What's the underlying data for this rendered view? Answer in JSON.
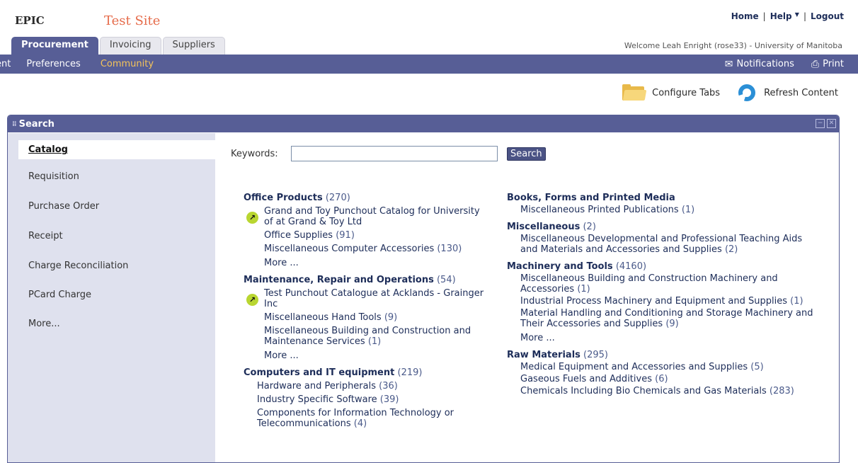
{
  "header": {
    "logo": "EPIC",
    "site_name": "Test Site",
    "links": {
      "home": "Home",
      "help": "Help",
      "logout": "Logout"
    },
    "welcome": "Welcome Leah Enright (rose33) - University of Manitoba"
  },
  "tabs": [
    "Procurement",
    "Invoicing",
    "Suppliers"
  ],
  "nav": {
    "items": [
      "ent",
      "Preferences",
      "Community"
    ],
    "notifications": "Notifications",
    "print": "Print"
  },
  "tools": {
    "configure": "Configure Tabs",
    "refresh": "Refresh Content"
  },
  "panel": {
    "title": "Search"
  },
  "sidebar": {
    "items": [
      "Catalog",
      "Requisition",
      "Purchase Order",
      "Receipt",
      "Charge Reconciliation",
      "PCard Charge",
      "More..."
    ]
  },
  "search": {
    "keywords_label": "Keywords:",
    "input_value": "",
    "button": "Search"
  },
  "catalog": {
    "office": {
      "title": "Office Products",
      "count": "(270)",
      "punchout": "Grand and Toy Punchout Catalog for University of at Grand & Toy Ltd",
      "items": [
        {
          "label": "Office Supplies",
          "count": "(91)"
        },
        {
          "label": "Miscellaneous Computer Accessories",
          "count": "(130)"
        }
      ],
      "more": "More ..."
    },
    "mro": {
      "title": "Maintenance, Repair and Operations",
      "count": "(54)",
      "punchout": "Test Punchout Catalogue at Acklands - Grainger Inc",
      "items": [
        {
          "label": "Miscellaneous Hand Tools",
          "count": "(9)"
        },
        {
          "label": "Miscellaneous Building and Construction and Maintenance Services",
          "count": "(1)"
        }
      ],
      "more": "More ..."
    },
    "computers": {
      "title": "Computers and IT equipment",
      "count": "(219)",
      "items": [
        {
          "label": "Hardware and Peripherals",
          "count": "(36)"
        },
        {
          "label": "Industry Specific Software",
          "count": "(39)"
        },
        {
          "label": "Components for Information Technology or Telecommunications",
          "count": "(4)"
        }
      ]
    },
    "books": {
      "title": "Books, Forms and Printed Media",
      "count": "",
      "items": [
        {
          "label": "Miscellaneous Printed Publications",
          "count": "(1)"
        }
      ]
    },
    "misc": {
      "title": "Miscellaneous",
      "count": "(2)",
      "items": [
        {
          "label": "Miscellaneous Developmental and Professional Teaching Aids and Materials and Accessories and Supplies",
          "count": "(2)"
        }
      ]
    },
    "machinery": {
      "title": "Machinery and Tools",
      "count": "(4160)",
      "items": [
        {
          "label": "Miscellaneous Building and Construction Machinery and Accessories",
          "count": "(1)"
        },
        {
          "label": "Industrial Process Machinery and Equipment and Supplies",
          "count": "(1)"
        },
        {
          "label": "Material Handling and Conditioning and Storage Machinery and Their Accessories and Supplies",
          "count": "(9)"
        }
      ],
      "more": "More ..."
    },
    "raw": {
      "title": "Raw Materials",
      "count": "(295)",
      "items": [
        {
          "label": "Medical Equipment and Accessories and Supplies",
          "count": "(5)"
        },
        {
          "label": "Gaseous Fuels and Additives",
          "count": "(6)"
        },
        {
          "label": "Chemicals Including Bio Chemicals and Gas Materials",
          "count": "(283)"
        }
      ]
    }
  },
  "colors": {
    "nav_bg": "#575e96",
    "link": "#1d2d59",
    "accent": "#f5c45a",
    "site_name": "#e66b4a"
  }
}
